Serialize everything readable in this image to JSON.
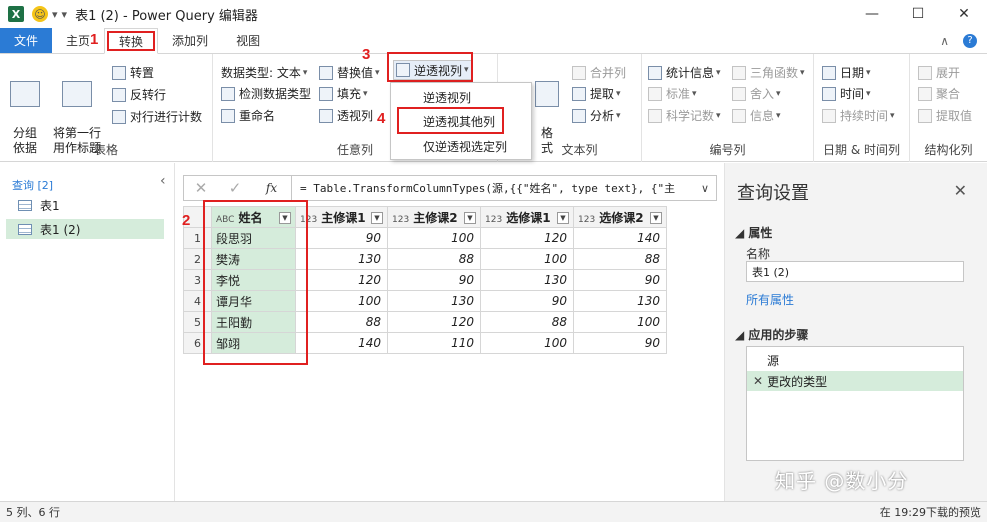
{
  "window": {
    "title": "表1 (2) - Power Query 编辑器",
    "app_icon": "X",
    "controls": [
      "—",
      "☐",
      "✕"
    ]
  },
  "tabs": [
    {
      "label": "文件"
    },
    {
      "label": "主页"
    },
    {
      "label": "转换"
    },
    {
      "label": "添加列"
    },
    {
      "label": "视图"
    }
  ],
  "ribbon": {
    "table_group": {
      "label": "表格",
      "group_by": "分组\n依据",
      "use_first_row": "将第一行\n用作标题",
      "transpose": "转置",
      "reverse_rows": "反转行",
      "count_rows": "对行进行计数"
    },
    "any_column_group": {
      "label": "任意列",
      "data_type": "数据类型: 文本",
      "detect_type": "检测数据类型",
      "rename": "重命名",
      "replace_values": "替换值",
      "fill": "填充",
      "pivot": "透视列",
      "unpivot": "逆透视列"
    },
    "text_column_group": {
      "label": "文本列",
      "format": "格\n式",
      "merge": "合并列",
      "extract": "提取",
      "parse": "分析"
    },
    "number_column_group": {
      "label": "编号列",
      "statistics": "统计信息",
      "standard": "标准",
      "scientific": "科学记数",
      "trigonometry": "三角函数",
      "rounding": "舍入",
      "information": "信息"
    },
    "datetime_group": {
      "label": "日期 & 时间列",
      "date": "日期",
      "time": "时间",
      "duration": "持续时间"
    },
    "structured_group": {
      "label": "结构化列",
      "expand": "展开",
      "aggregate": "聚合",
      "extract_values": "提取值"
    }
  },
  "unpivot_menu": [
    {
      "label": "逆透视列"
    },
    {
      "label": "逆透视其他列"
    },
    {
      "label": "仅逆透视选定列"
    }
  ],
  "markers": [
    "1",
    "2",
    "3",
    "4"
  ],
  "queries": {
    "header": "查询 [2]",
    "items": [
      {
        "label": "表1"
      },
      {
        "label": "表1 (2)"
      }
    ]
  },
  "formula_bar": {
    "fx": "fx",
    "formula": "= Table.TransformColumnTypes(源,{{\"姓名\", type text}, {\"主"
  },
  "grid": {
    "columns": [
      {
        "type": "ABC",
        "name": "姓名"
      },
      {
        "type": "123",
        "name": "主修课1"
      },
      {
        "type": "123",
        "name": "主修课2"
      },
      {
        "type": "123",
        "name": "选修课1"
      },
      {
        "type": "123",
        "name": "选修课2"
      }
    ],
    "rows": [
      {
        "n": "1",
        "name": "段思羽",
        "c1": "90",
        "c2": "100",
        "c3": "120",
        "c4": "140"
      },
      {
        "n": "2",
        "name": "樊涛",
        "c1": "130",
        "c2": "88",
        "c3": "100",
        "c4": "88"
      },
      {
        "n": "3",
        "name": "李悦",
        "c1": "120",
        "c2": "90",
        "c3": "130",
        "c4": "90"
      },
      {
        "n": "4",
        "name": "谭月华",
        "c1": "100",
        "c2": "130",
        "c3": "90",
        "c4": "130"
      },
      {
        "n": "5",
        "name": "王阳勤",
        "c1": "88",
        "c2": "120",
        "c3": "88",
        "c4": "100"
      },
      {
        "n": "6",
        "name": "邹翊",
        "c1": "140",
        "c2": "110",
        "c3": "100",
        "c4": "90"
      }
    ]
  },
  "settings": {
    "title": "查询设置",
    "properties_header": "属性",
    "name_label": "名称",
    "name_value": "表1 (2)",
    "all_properties_link": "所有属性",
    "steps_header": "应用的步骤",
    "steps": [
      {
        "label": "源"
      },
      {
        "label": "更改的类型"
      }
    ]
  },
  "watermark": "知乎 @数小分",
  "status": {
    "left": "5 列、6 行",
    "right": "在 19:29下载的预览"
  }
}
